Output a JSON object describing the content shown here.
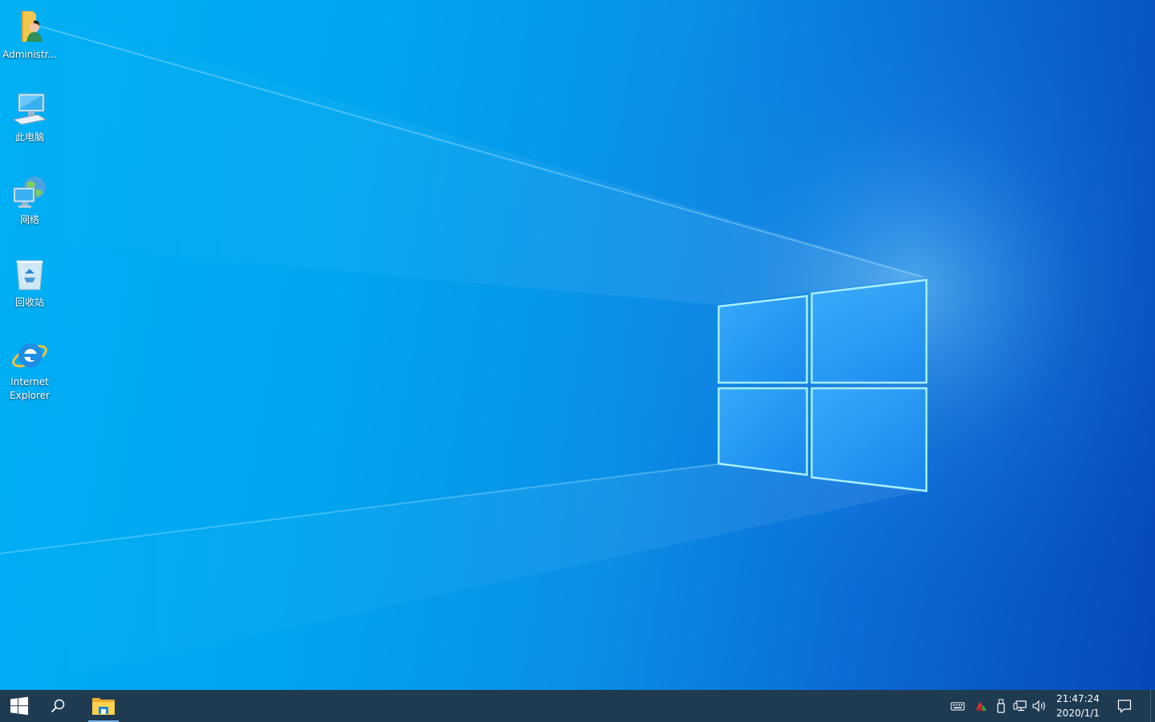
{
  "desktop": {
    "icons": [
      {
        "label": "Administr...",
        "icon": "user-folder-icon"
      },
      {
        "label": "此电脑",
        "icon": "this-pc-icon"
      },
      {
        "label": "网络",
        "icon": "network-icon"
      },
      {
        "label": "回收站",
        "icon": "recycle-bin-icon"
      },
      {
        "label": "Internet Explorer",
        "icon": "internet-explorer-icon"
      }
    ]
  },
  "taskbar": {
    "start_icon": "windows-logo-icon",
    "search_icon": "search-icon",
    "pinned": [
      {
        "icon": "file-explorer-icon",
        "active": true
      }
    ],
    "tray_icons": [
      "keyboard-icon",
      "app-tray-icon",
      "usb-device-icon",
      "network-status-icon",
      "volume-icon"
    ],
    "clock": {
      "time": "21:47:24",
      "date": "2020/1/1"
    },
    "notification_icon": "action-center-icon"
  },
  "colors": {
    "wallpaper_light": "#00b0f5",
    "wallpaper_dark": "#0747b8",
    "taskbar": "#1f3b52",
    "window_glow": "#9fe6ff"
  }
}
